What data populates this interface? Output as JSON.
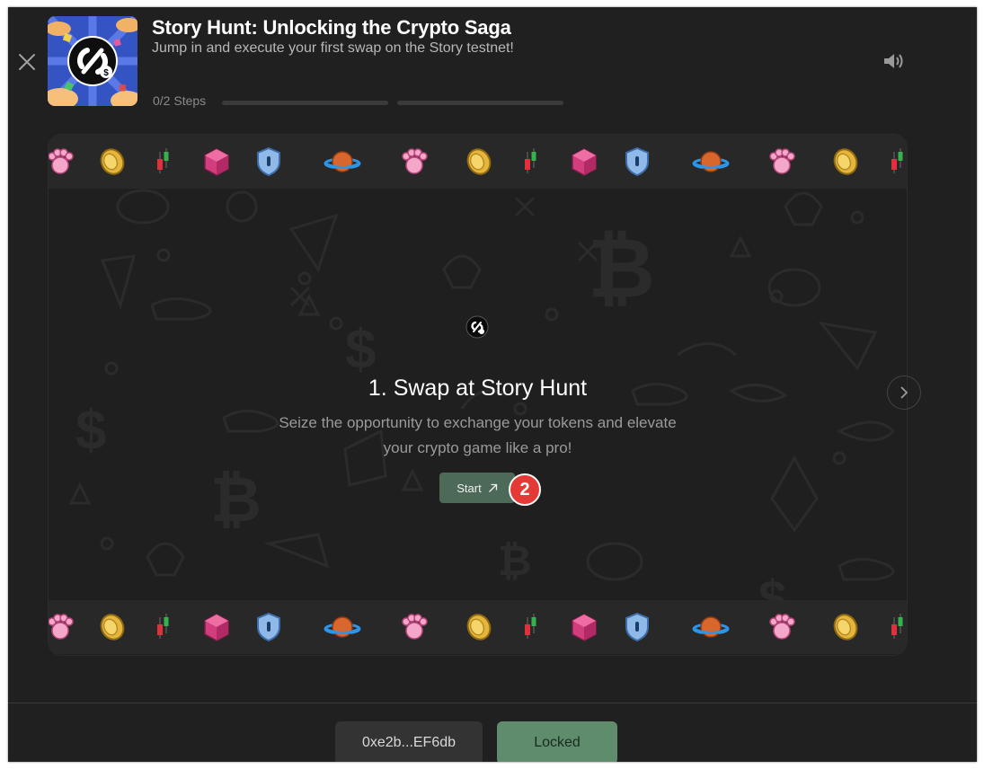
{
  "header": {
    "title": "Story Hunt: Unlocking the Crypto Saga",
    "subtitle": "Jump in and execute your first swap on the Story testnet!",
    "steps_label": "0/2 Steps",
    "progress": [
      0,
      0
    ],
    "icons": {
      "close": "close-icon",
      "logo": "story-hunt-logo",
      "sound": "speaker-icon"
    }
  },
  "card": {
    "step_title": "1. Swap at Story Hunt",
    "step_description": "Seize the opportunity to exchange your tokens and elevate your crypto game like a pro!",
    "start_label": "Start",
    "start_icon": "arrow-up-right-icon",
    "badge": "2",
    "next_icon": "chevron-right-icon",
    "band_icons": [
      "paw-icon",
      "coin-icon",
      "candlestick-icon",
      "gem-icon",
      "shield-icon",
      "planet-icon",
      "paw-icon",
      "coin-icon",
      "candlestick-icon",
      "gem-icon",
      "shield-icon",
      "planet-icon",
      "paw-icon",
      "coin-icon",
      "candlestick-icon"
    ]
  },
  "footer": {
    "wallet_label": "0xe2b...EF6db",
    "locked_label": "Locked"
  },
  "colors": {
    "background": "#202020",
    "accent_green": "#5e8c6d",
    "start_button": "#4d6a58",
    "badge_red": "#e53935"
  }
}
